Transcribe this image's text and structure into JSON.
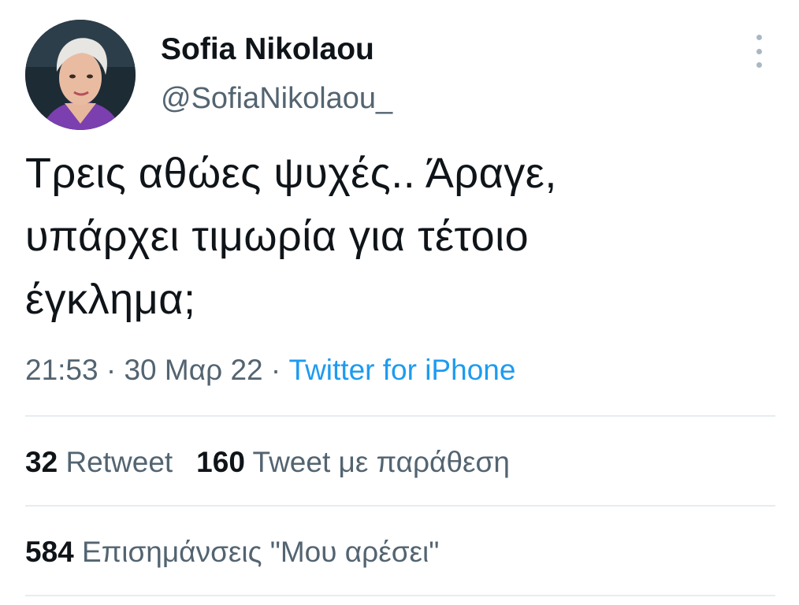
{
  "author": {
    "display_name": "Sofia Nikolaou",
    "handle": "@SofiaNikolaou_"
  },
  "tweet": {
    "text": "Τρεις αθώες ψυχές.. Άραγε,\nυπάρχει τιμωρία για τέτοιο\nέγκλημα;",
    "time": "21:53",
    "separator": " · ",
    "date": "30 Μαρ 22",
    "source": "Twitter for iPhone"
  },
  "stats": {
    "retweets": {
      "count": "32",
      "label": "Retweet"
    },
    "quotes": {
      "count": "160",
      "label": "Tweet με παράθεση"
    },
    "likes": {
      "count": "584",
      "label": "Επισημάνσεις \"Μου αρέσει\""
    }
  },
  "icons": {
    "more": "more-vertical-icon"
  },
  "colors": {
    "text_primary": "#0f1419",
    "text_secondary": "#536471",
    "link": "#1d9bf0",
    "divider": "#e6ecf0"
  }
}
